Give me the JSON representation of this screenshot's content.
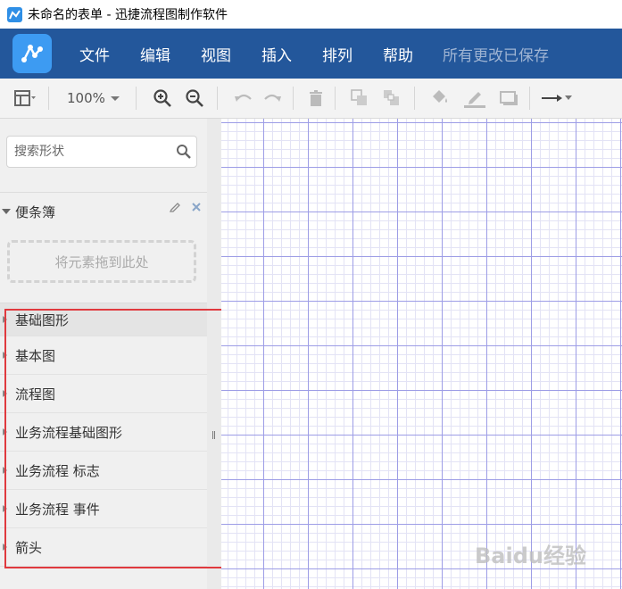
{
  "window": {
    "title": "未命名的表单 - 迅捷流程图制作软件"
  },
  "menu": {
    "items": [
      "文件",
      "编辑",
      "视图",
      "插入",
      "排列",
      "帮助"
    ],
    "save_status": "所有更改已保存"
  },
  "toolbar": {
    "zoom": "100%"
  },
  "sidebar": {
    "search_placeholder": "搜索形状",
    "notes_title": "便条簿",
    "drop_hint": "将元素拖到此处",
    "libraries": [
      "基础图形",
      "基本图",
      "流程图",
      "业务流程基础图形",
      "业务流程 标志",
      "业务流程 事件",
      "箭头"
    ]
  },
  "colors": {
    "menubar": "#23579b",
    "logo": "#3d9bf2",
    "highlight": "#e0393e",
    "grid_major": "#9d9de6"
  },
  "watermark": "Baidu经验"
}
